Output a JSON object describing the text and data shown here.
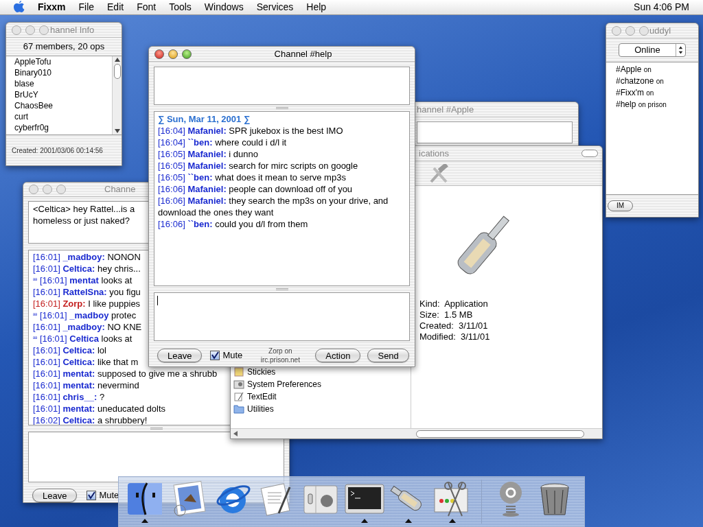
{
  "menu_bar": {
    "app": "Fixxm",
    "menus": [
      "File",
      "Edit",
      "Font",
      "Tools",
      "Windows",
      "Services",
      "Help"
    ],
    "clock": "Sun 4:06 PM"
  },
  "channel_info": {
    "title": "hannel Info",
    "active": false,
    "summary": "67 members, 20 ops",
    "members": [
      "AppleTofu",
      "Binary010",
      "blase",
      "BrUcY",
      "ChaosBee",
      "curt",
      "cyberfr0g"
    ],
    "created": "Created: 2001/03/06 00:14:56"
  },
  "left_channel": {
    "title": "Channe",
    "active": false,
    "topic": "<Celtica> hey Rattel...is a homeless or just naked?",
    "lines": [
      {
        "kind": "message",
        "time": "[16:01]",
        "nick": "_madboy:",
        "text": "NONON",
        "color": "#1a2ad0"
      },
      {
        "kind": "message",
        "time": "[16:01]",
        "nick": "Celtica:",
        "text": "hey chris...",
        "color": "#1a2ad0"
      },
      {
        "kind": "action",
        "marker": "ªª",
        "time": "[16:01]",
        "nick": "mentat",
        "text": "looks at",
        "color": "#1a2ad0"
      },
      {
        "kind": "message",
        "time": "[16:01]",
        "nick": "RattelSna:",
        "text": "you figu",
        "color": "#1a2ad0"
      },
      {
        "kind": "message",
        "time": "[16:01]",
        "nick": "Zorp:",
        "text": "I like puppies",
        "color": "#c42020"
      },
      {
        "kind": "action",
        "marker": "ªª",
        "time": "[16:01]",
        "nick": "_madboy",
        "text": "protec",
        "color": "#1a2ad0"
      },
      {
        "kind": "message",
        "time": "[16:01]",
        "nick": "_madboy:",
        "text": "NO KNE",
        "color": "#1a2ad0"
      },
      {
        "kind": "action",
        "marker": "ªª",
        "time": "[16:01]",
        "nick": "Celtica",
        "text": "looks at",
        "color": "#1a2ad0"
      },
      {
        "kind": "message",
        "time": "[16:01]",
        "nick": "Celtica:",
        "text": "lol",
        "color": "#1a2ad0"
      },
      {
        "kind": "message",
        "time": "[16:01]",
        "nick": "Celtica:",
        "text": "like that m",
        "color": "#1a2ad0"
      },
      {
        "kind": "message",
        "time": "[16:01]",
        "nick": "mentat:",
        "text": "supposed to give me a shrubb",
        "color": "#1a2ad0"
      },
      {
        "kind": "message",
        "time": "[16:01]",
        "nick": "mentat:",
        "text": "nevermind",
        "color": "#1a2ad0"
      },
      {
        "kind": "message",
        "time": "[16:01]",
        "nick": "chris__:",
        "text": "?",
        "color": "#1a2ad0"
      },
      {
        "kind": "message",
        "time": "[16:01]",
        "nick": "mentat:",
        "text": "uneducated dolts",
        "color": "#1a2ad0"
      },
      {
        "kind": "message",
        "time": "[16:02]",
        "nick": "Celtica:",
        "text": "a shrubbery!",
        "color": "#1a2ad0"
      }
    ],
    "leave": "Leave",
    "mute": {
      "label": "Mute",
      "checked": true
    }
  },
  "apple_channel": {
    "title": "hannel #Apple"
  },
  "finder": {
    "title": "ications",
    "items": [
      {
        "kind": "stickies",
        "label": "Stickies"
      },
      {
        "kind": "prefs",
        "label": "System Preferences"
      },
      {
        "kind": "textedit",
        "label": "TextEdit"
      },
      {
        "kind": "folder",
        "label": "Utilities"
      }
    ],
    "info": [
      "Kind:  Application",
      "Size:  1.5 MB",
      "Created:  3/11/01",
      "Modified:  3/11/01"
    ]
  },
  "help_channel": {
    "title": "Channel #help",
    "active": true,
    "date_header": "∑ Sun, Mar 11, 2001 ∑",
    "lines": [
      {
        "time": "[16:04]",
        "nick": "Mafaniel:",
        "text": "SPR jukebox is the best IMO",
        "color": "#1a2ad0"
      },
      {
        "time": "[16:04]",
        "nick": "``ben:",
        "text": "where could i d/l it",
        "color": "#1a2ad0"
      },
      {
        "time": "[16:05]",
        "nick": "Mafaniel:",
        "text": "i dunno",
        "color": "#1a2ad0"
      },
      {
        "time": "[16:05]",
        "nick": "Mafaniel:",
        "text": "search for mirc scripts on google",
        "color": "#1a2ad0"
      },
      {
        "time": "[16:05]",
        "nick": "``ben:",
        "text": "what does it mean to serve mp3s",
        "color": "#1a2ad0"
      },
      {
        "time": "[16:06]",
        "nick": "Mafaniel:",
        "text": "people can download off of you",
        "color": "#1a2ad0"
      },
      {
        "time": "[16:06]",
        "nick": "Mafaniel:",
        "text": "they search the mp3s on your drive, and download the ones they want",
        "color": "#1a2ad0"
      },
      {
        "time": "[16:06]",
        "nick": "``ben:",
        "text": "could you d/l from them",
        "color": "#1a2ad0"
      }
    ],
    "leave": "Leave",
    "mute": {
      "label": "Mute",
      "checked": true
    },
    "status": "Zorp on irc.prison.net",
    "action": "Action",
    "send": "Send"
  },
  "buddy": {
    "title": "uddyl",
    "active": false,
    "status": "Online",
    "channels": [
      {
        "name": "#Apple",
        "server": "on"
      },
      {
        "name": "#chatzone",
        "server": "on"
      },
      {
        "name": "#Fixx'm",
        "server": "on"
      },
      {
        "name": "#help",
        "server": "on prison"
      }
    ],
    "im": "IM"
  },
  "dock": [
    {
      "kind": "finder",
      "running": true
    },
    {
      "kind": "mail",
      "running": false
    },
    {
      "kind": "browser",
      "running": false
    },
    {
      "kind": "textedit",
      "running": false
    },
    {
      "kind": "prefs",
      "running": false
    },
    {
      "kind": "terminal",
      "running": true
    },
    {
      "kind": "bottle",
      "running": true
    },
    {
      "kind": "scissors",
      "running": true
    },
    {
      "kind": "at",
      "running": false
    },
    {
      "kind": "trash",
      "running": false
    }
  ]
}
